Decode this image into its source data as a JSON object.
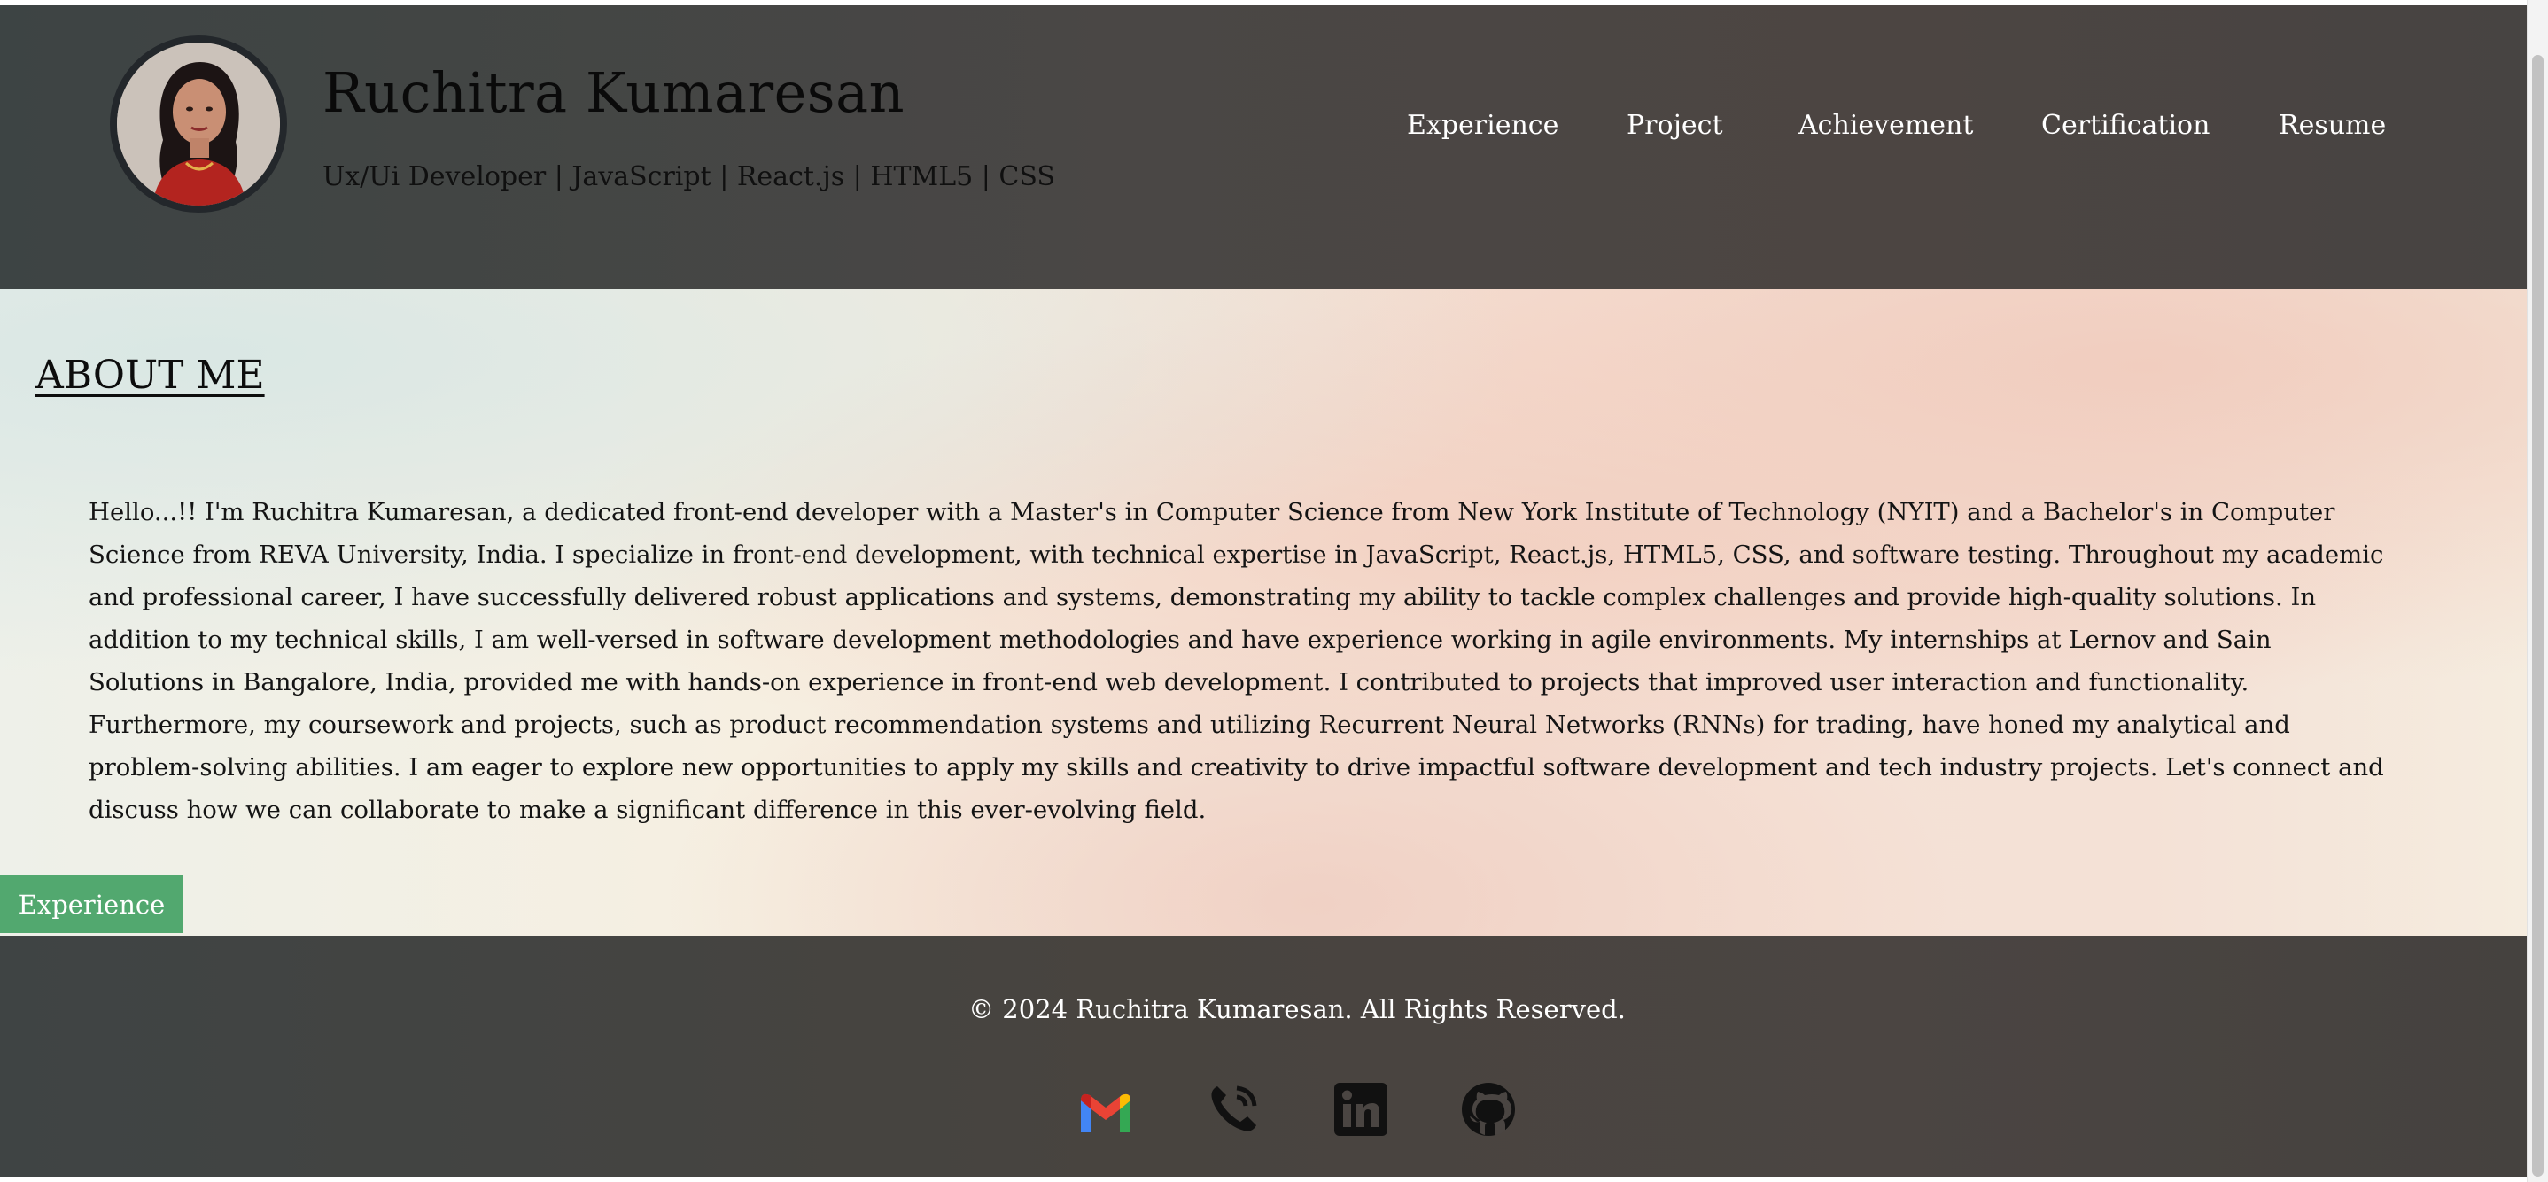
{
  "header": {
    "name": "Ruchitra Kumaresan",
    "tagline": "Ux/Ui Developer | JavaScript | React.js | HTML5 | CSS"
  },
  "nav": [
    "Experience",
    "Project",
    "Achievement",
    "Certification",
    "Resume"
  ],
  "about": {
    "heading": "ABOUT ME",
    "text": "Hello...!! I'm Ruchitra Kumaresan, a dedicated front-end developer with a Master's in Computer Science from New York Institute of Technology (NYIT) and a Bachelor's in Computer Science from REVA University, India. I specialize in front-end development, with technical expertise in JavaScript, React.js, HTML5, CSS, and software testing. Throughout my academic and professional career, I have successfully delivered robust applications and systems, demonstrating my ability to tackle complex challenges and provide high-quality solutions. In addition to my technical skills, I am well-versed in software development methodologies and have experience working in agile environments. My internships at Lernov and Sain Solutions in Bangalore, India, provided me with hands-on experience in front-end web development. I contributed to projects that improved user interaction and functionality. Furthermore, my coursework and projects, such as product recommendation systems and utilizing Recurrent Neural Networks (RNNs) for trading, have honed my analytical and problem-solving abilities. I am eager to explore new opportunities to apply my skills and creativity to drive impactful software development and tech industry projects. Let's connect and discuss how we can collaborate to make a significant difference in this ever-evolving field."
  },
  "experience_button": "Experience",
  "footer": {
    "copyright": "© 2024 Ruchitra Kumaresan. All Rights Reserved.",
    "social_icons": [
      "gmail-icon",
      "phone-icon",
      "linkedin-icon",
      "github-icon"
    ]
  },
  "colors": {
    "header_bg": "#474442",
    "button_green": "#52a86f",
    "nav_text": "#ffffff"
  }
}
